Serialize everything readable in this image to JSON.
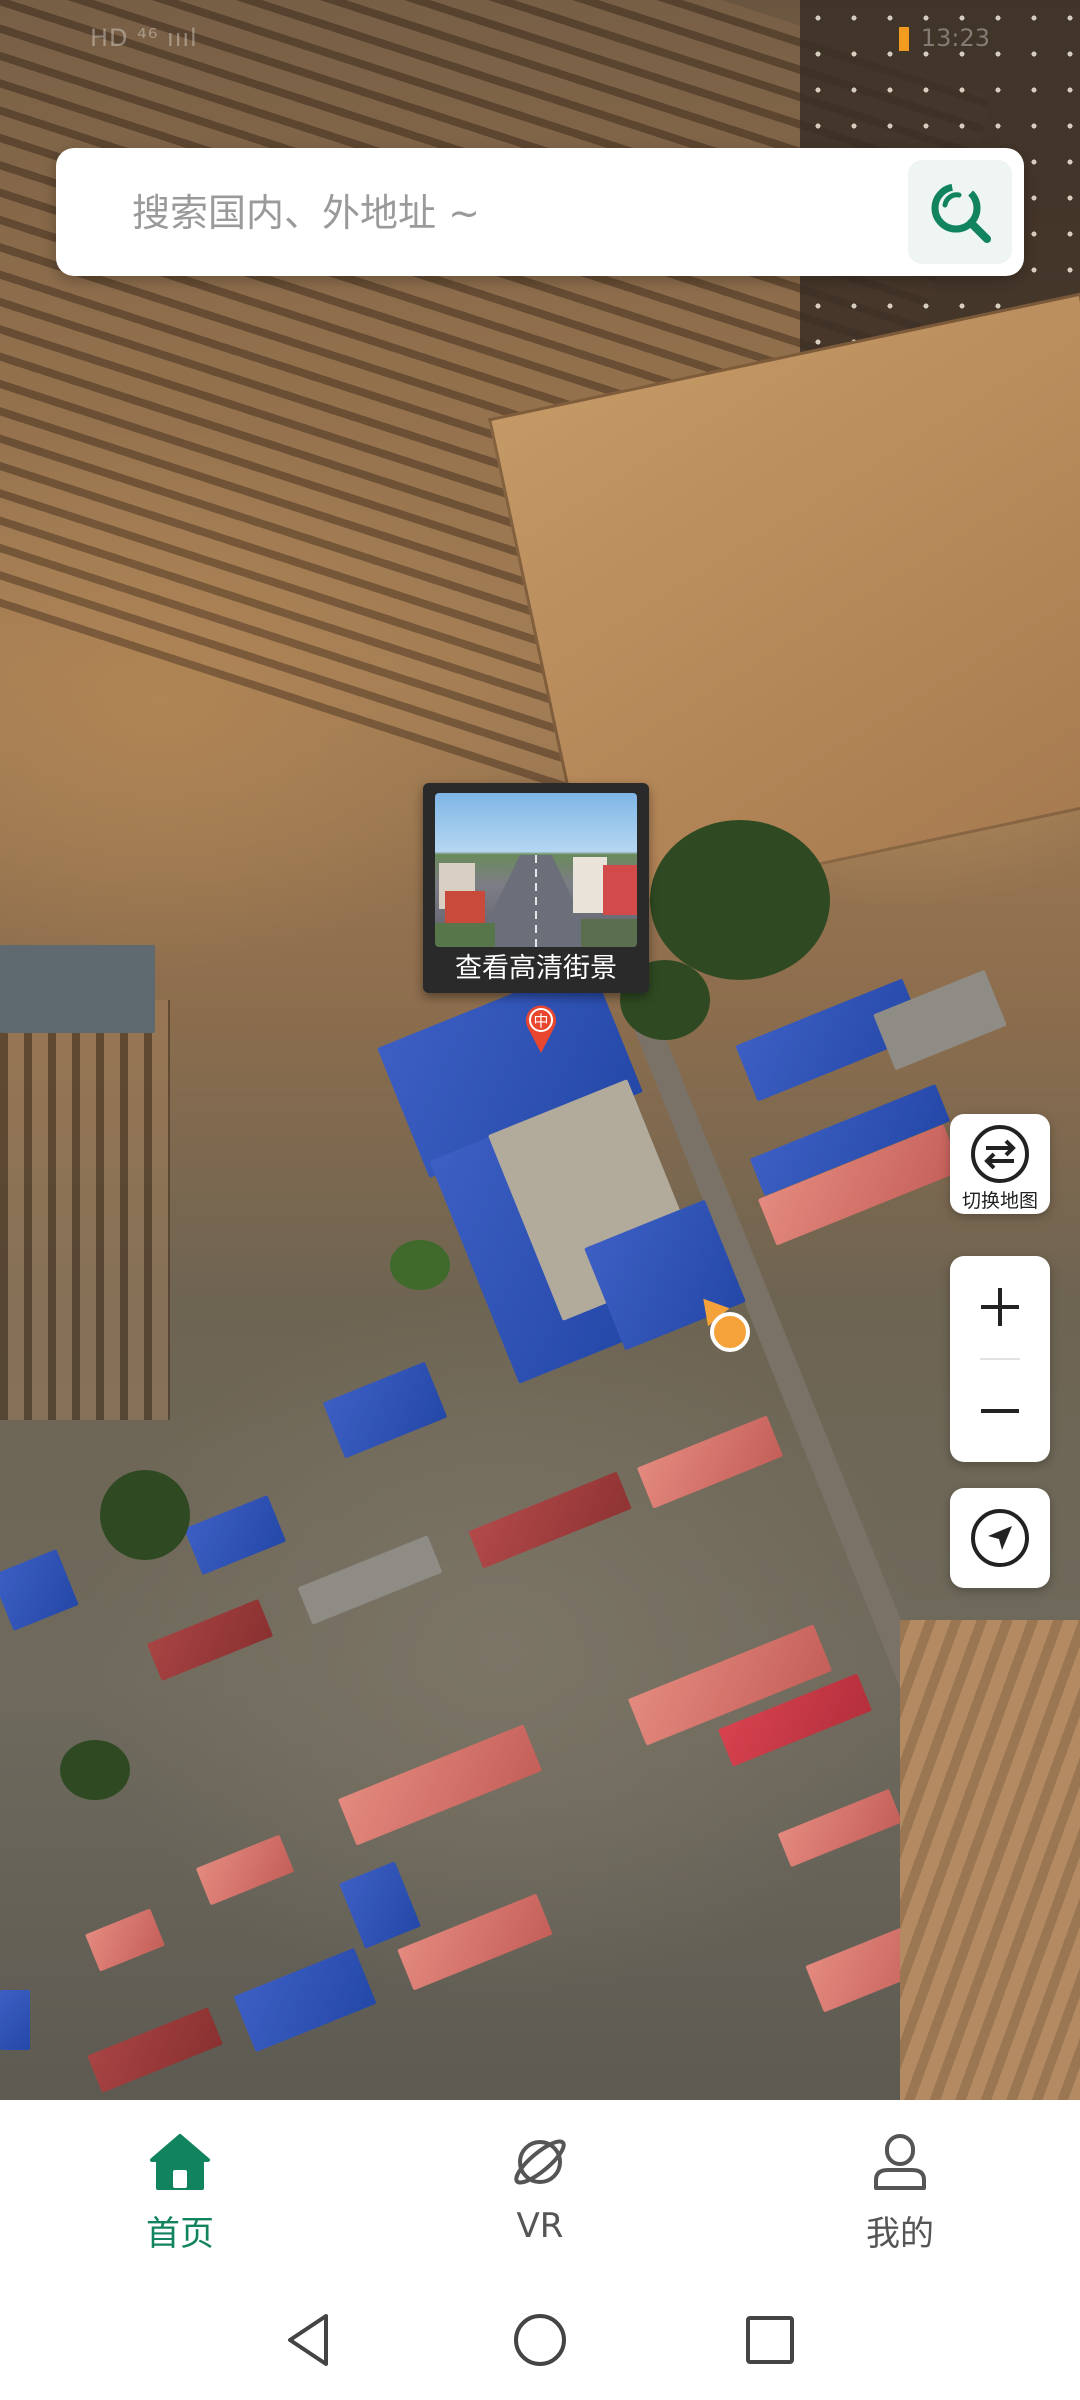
{
  "status_bar": {
    "left_text": "HD ⁴⁶ ıııl",
    "right_text": "13:23"
  },
  "search": {
    "placeholder": "搜索国内、外地址 ~",
    "value": ""
  },
  "street_view": {
    "label": "查看高清街景",
    "marker_text": "中"
  },
  "controls": {
    "switch_map_label": "切换地图",
    "zoom_in": "+",
    "zoom_out": "−"
  },
  "bottom_nav": {
    "items": [
      {
        "label": "首页",
        "icon": "home-icon",
        "active": true
      },
      {
        "label": "VR",
        "icon": "planet-icon",
        "active": false
      },
      {
        "label": "我的",
        "icon": "user-icon",
        "active": false
      }
    ]
  },
  "colors": {
    "accent": "#12835f",
    "marker": "#e8462f",
    "location": "#f5a23a"
  }
}
